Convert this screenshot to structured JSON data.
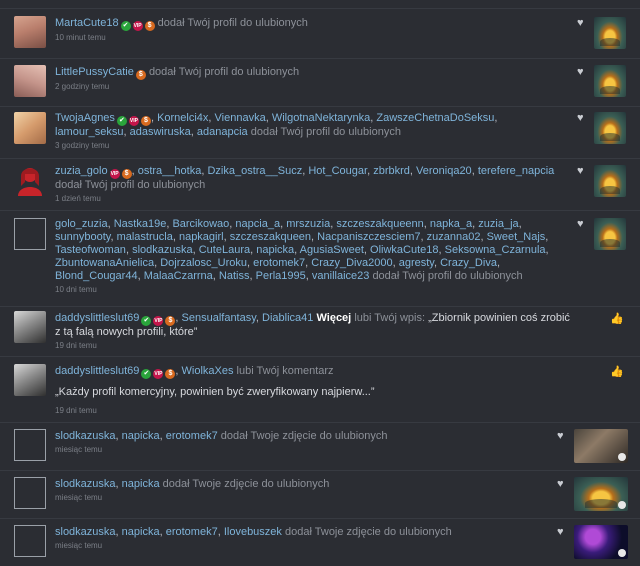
{
  "colors": {
    "background": "#2b2d33",
    "link": "#7fb4da",
    "text": "#8d9199",
    "time": "#7b7f87",
    "check": "#2aa43b",
    "vip": "#c4154a",
    "dollar": "#d86a1f"
  },
  "badges": {
    "check": "✔",
    "vip": "VIP",
    "dollar": "$"
  },
  "icons": {
    "heart": "♥",
    "thumb": "👍",
    "person": "person-icon"
  },
  "notifications": [
    {
      "users": [
        "MartaCute18"
      ],
      "action": "dodał Twój profil do ulubionych",
      "time": "10 minut temu"
    },
    {
      "users": [
        "LittlePussyCatie"
      ],
      "action": "dodał Twój profil do ulubionych",
      "time": "2 godziny temu"
    },
    {
      "users": [
        "TwojaAgnes",
        "Kornelci4x",
        "Viennavka",
        "WilgotnaNektarynka",
        "ZawszeChetnaDoSeksu",
        "lamour_seksu",
        "adaswiruska",
        "adanapcia"
      ],
      "action": "dodał Twój profil do ulubionych",
      "time": "3 godziny temu"
    },
    {
      "users": [
        "zuzia_golo",
        "ostra__hotka",
        "Dzika_ostra__Sucz",
        "Hot_Cougar",
        "zbrbkrd",
        "Veroniqa20",
        "terefere_napcia"
      ],
      "action": "dodał Twój profil do ulubionych",
      "time": "1 dzień temu"
    },
    {
      "users": [
        "golo_zuzia",
        "Nastka19e",
        "Barcikowao",
        "napcia_a",
        "mrszuzia",
        "szczeszakqueenn",
        "napka_a",
        "zuzia_ja",
        "sunnybooty",
        "malastrucla",
        "napkagirl",
        "szczeszakqueen",
        "Nacpaniszczesciem7",
        "zuzanna02",
        "Sweet_Najs",
        "Tasteofwoman",
        "slodkazuska",
        "CuteLaura",
        "napicka",
        "AgusiaSweet",
        "OliwkaCute18",
        "Seksowna_Czarnula",
        "ZbuntowanaAnielica",
        "Dojrzalosc_Uroku",
        "erotomek7",
        "Crazy_Diva2000",
        "agresty",
        "Crazy_Diva",
        "Blond_Cougar44",
        "MalaaCzarrna",
        "Natiss",
        "Perla1995",
        "vanillaice23"
      ],
      "action": "dodał Twój profil do ulubionych",
      "time": "10 dni temu"
    },
    {
      "users": [
        "daddyslittleslut69",
        "Sensualfantasy",
        "Diablica41"
      ],
      "more": "Więcej",
      "action": "lubi Twój wpis:",
      "quote": "„Zbiornik powinien coś zrobić z tą falą nowych profili, które”",
      "time": "19 dni temu"
    },
    {
      "users": [
        "daddyslittleslut69",
        "WiolkaXes"
      ],
      "action": "lubi Twój komentarz",
      "quote": "„Każdy profil komercyjny, powinien być zweryfikowany najpierw...”",
      "time": "19 dni temu"
    },
    {
      "users": [
        "slodkazuska",
        "napicka",
        "erotomek7"
      ],
      "action": "dodał Twoje zdjęcie do ulubionych",
      "time": "miesiąc temu"
    },
    {
      "users": [
        "slodkazuska",
        "napicka"
      ],
      "action": "dodał Twoje zdjęcie do ulubionych",
      "time": "miesiąc temu"
    },
    {
      "users": [
        "slodkazuska",
        "napicka",
        "erotomek7",
        "Ilovebuszek"
      ],
      "action": "dodał Twoje zdjęcie do ulubionych",
      "time": "miesiąc temu"
    }
  ]
}
